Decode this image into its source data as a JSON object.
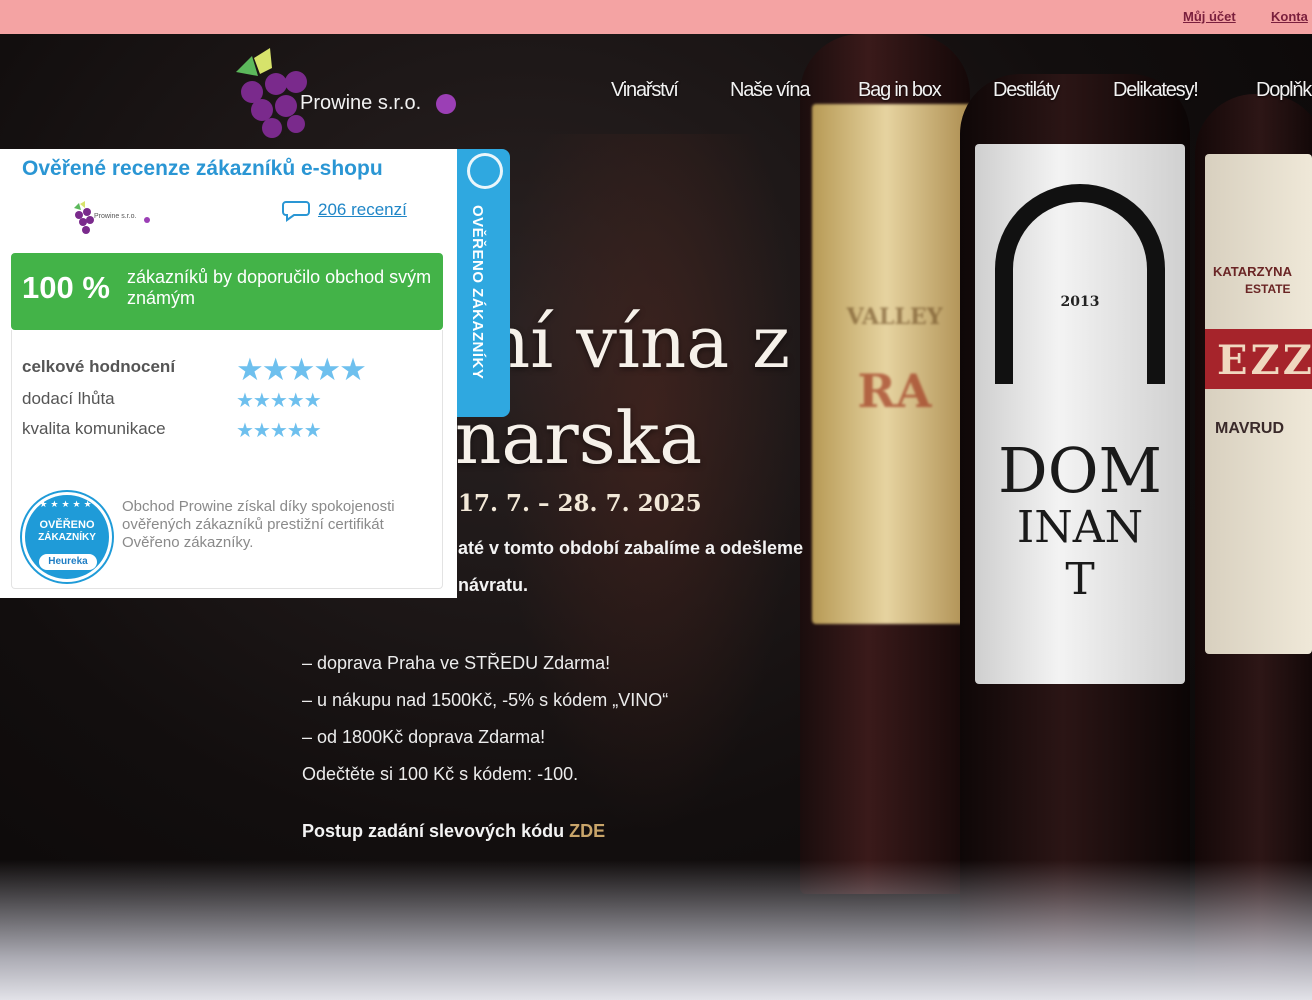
{
  "topbar": {
    "account_link": "Můj účet",
    "contact_link": "Konta"
  },
  "brand": {
    "name": "Prowine s.r.o."
  },
  "nav": {
    "items": [
      "Vinařství",
      "Naše vína",
      "Bag in box",
      "Destiláty",
      "Delikatesy!",
      "Doplňk"
    ]
  },
  "hero": {
    "heading_line1": "tní vína z",
    "heading_line2": "narska",
    "dates": "17. 7. – 28. 7. 2025",
    "notice_line1": "até v tomto období zabalíme a odešleme",
    "notice_line2": "návratu.",
    "promo_lines": [
      "– doprava Praha ve STŘEDU Zdarma!",
      "– u nákupu nad 1500Kč, -5% s kódem „VINO“",
      "– od 1800Kč doprava Zdarma!",
      "Odečtěte si 100 Kč s kódem: -100."
    ],
    "promo_link_prefix": "Postup zadání slevových kódu ",
    "promo_link": "ZDE"
  },
  "reviews_widget": {
    "title": "Ověřené recenze zákazníků e-shopu",
    "logo_text": "Prowine s.r.o.",
    "reviews_count": "206 recenzí",
    "recommend_percent": "100 %",
    "recommend_text": "zákazníků by doporučilo obchod svým známým",
    "ratings": [
      {
        "label": "celkové hodnocení",
        "stars": 5
      },
      {
        "label": "dodací lhůta",
        "stars": 5
      },
      {
        "label": "kvalita komunikace",
        "stars": 5
      }
    ],
    "certificate_text": "Obchod Prowine získal díky spokojenosti ověřených zákazníků prestižní certifikát Ověřeno zákazníky.",
    "badge_line1": "OVĚŘENO",
    "badge_line2": "ZÁKAZNÍKY",
    "badge_brand": "Heureka",
    "side_tab": "OVĚŘENO ZÁKAZNÍKY"
  },
  "bottle_labels": {
    "katarzyna": "KATARZYNA",
    "estate": "ESTATE",
    "ezz": "EZZ",
    "mavrud": "MAVRUD",
    "dom": "DOM",
    "inan": "INAN",
    "t": "T",
    "year": "2013",
    "ra": "RA",
    "valley": "VALLEY"
  },
  "colors": {
    "topbar": "#f4a3a3",
    "widget_accent": "#2a96d4",
    "recommend_green": "#43b348",
    "side_tab": "#2fa8e0",
    "promo_link": "#c9a56a",
    "grape_purple": "#7a2a8c"
  }
}
